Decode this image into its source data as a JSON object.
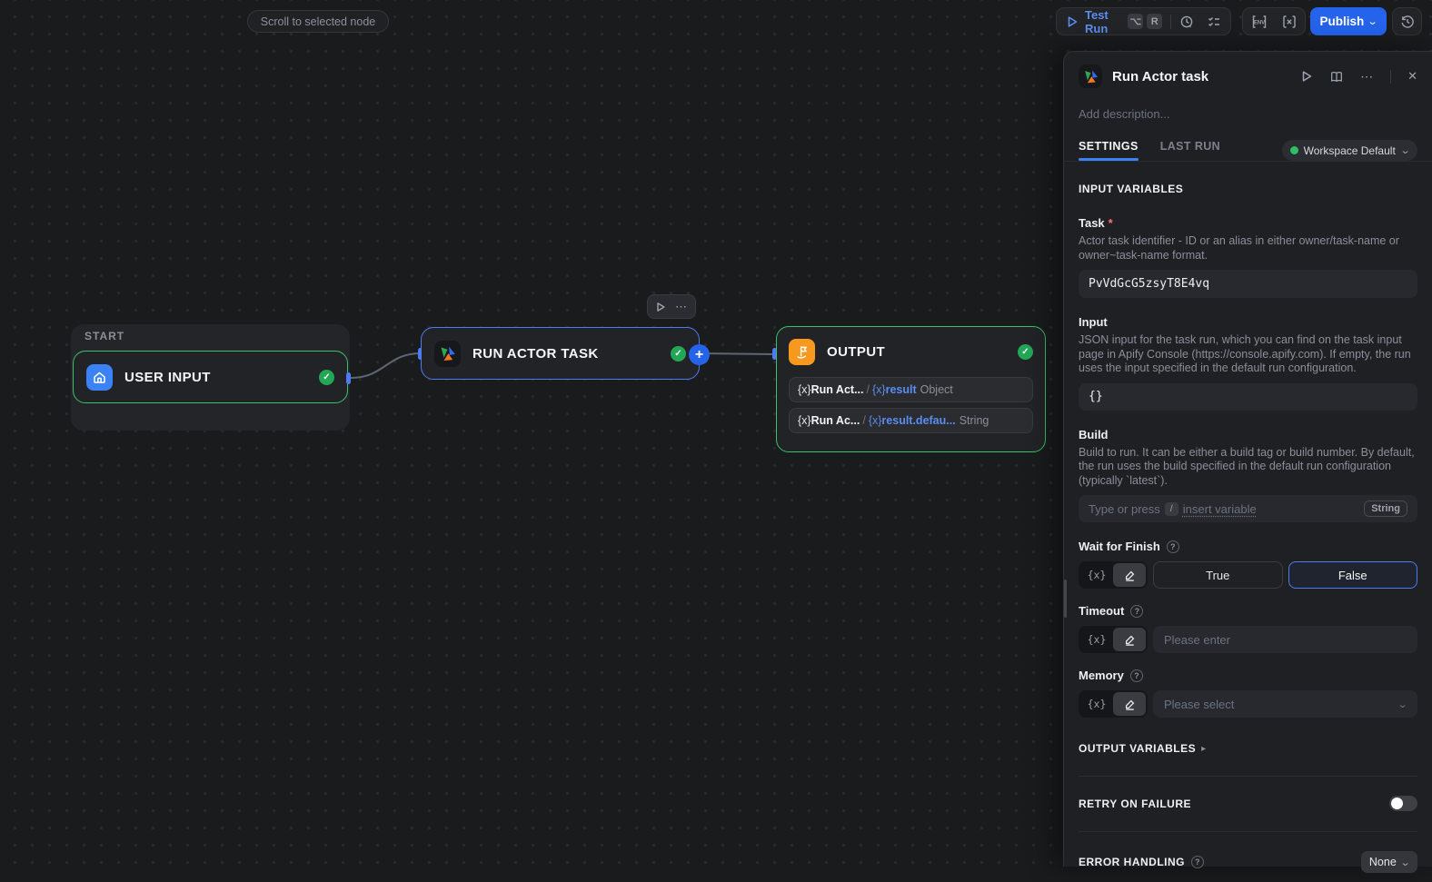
{
  "colors": {
    "accent_blue": "#2563eb",
    "node_blue": "#4e7cf0",
    "node_green": "#3cbf6c",
    "check_green": "#23a656",
    "output_orange": "#f7981f",
    "variable_blue": "#5b8def"
  },
  "topbar": {
    "scroll_to_node": "Scroll to selected node",
    "test_run": "Test Run",
    "shortcut_opt": "⌥",
    "shortcut_r": "R",
    "publish": "Publish"
  },
  "icons": {
    "more": "⋯",
    "close": "✕",
    "chevron_down": "⌄",
    "help": "?",
    "plus": "+",
    "check": "✓",
    "collapse_arrow": "▸",
    "fx": "{x}"
  },
  "canvas": {
    "start_label": "START",
    "user_input": {
      "title": "USER INPUT"
    },
    "run_actor": {
      "title": "RUN ACTOR TASK"
    },
    "output": {
      "title": "OUTPUT",
      "rows": [
        {
          "prefix": "{x}",
          "name": "Run Act...",
          "slash": "/",
          "fx": "{x}",
          "var_name": "result",
          "type": "Object"
        },
        {
          "prefix": "{x}",
          "name": "Run Ac...",
          "slash": "/",
          "fx": "{x}",
          "var_name": "result.defau...",
          "type": "String"
        }
      ]
    }
  },
  "panel": {
    "title": "Run Actor task",
    "description_placeholder": "Add description...",
    "tab_settings": "SETTINGS",
    "tab_last_run": "LAST RUN",
    "workspace": "Workspace Default",
    "input_variables_header": "INPUT VARIABLES",
    "task": {
      "label": "Task",
      "required": "*",
      "description": "Actor task identifier - ID or an alias in either owner/task-name or owner~task-name format.",
      "value": "PvVdGcG5zsyT8E4vq"
    },
    "input": {
      "label": "Input",
      "description": "JSON input for the task run, which you can find on the task input page in Apify Console (https://console.apify.com). If empty, the run uses the input specified in the default run configuration.",
      "value": "{}"
    },
    "build": {
      "label": "Build",
      "description": "Build to run. It can be either a build tag or build number. By default, the run uses the build specified in the default run configuration (typically `latest`).",
      "placeholder_pre": "Type or press",
      "placeholder_key": "/",
      "placeholder_post": "insert variable",
      "type_badge": "String"
    },
    "wait_for_finish": {
      "label": "Wait for Finish",
      "true_label": "True",
      "false_label": "False"
    },
    "timeout": {
      "label": "Timeout",
      "placeholder": "Please enter"
    },
    "memory": {
      "label": "Memory",
      "placeholder": "Please select"
    },
    "output_variables_header": "OUTPUT VARIABLES",
    "retry_header": "RETRY ON FAILURE",
    "error_header": "ERROR HANDLING",
    "error_value": "None"
  }
}
